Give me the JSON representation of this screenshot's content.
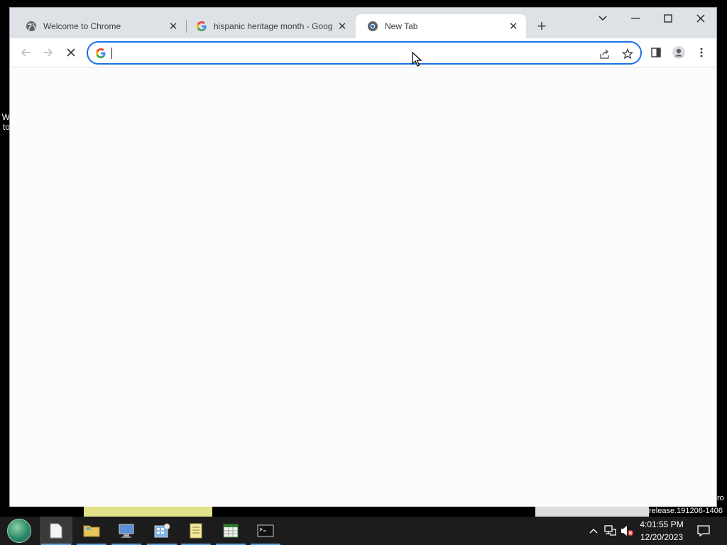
{
  "desktop": {
    "left_text": "W\nto",
    "right_text_a": "ro",
    "right_text_b": "release.191206-1406"
  },
  "browser": {
    "tabs": [
      {
        "title": "Welcome to Chrome",
        "icon": "globe-icon",
        "active": false
      },
      {
        "title": "hispanic heritage month - Google Search",
        "icon": "google-g-icon",
        "active": false
      },
      {
        "title": "New Tab",
        "icon": "chrome-icon",
        "active": true
      }
    ],
    "new_tab_label": "+",
    "omnibox": {
      "value": "",
      "placeholder": ""
    },
    "accent_color": "#1a73e8"
  },
  "taskbar": {
    "apps": [
      {
        "name": "file-explorer",
        "icon": "document-icon",
        "running": true,
        "active": true
      },
      {
        "name": "folder",
        "icon": "folder-icon",
        "running": true
      },
      {
        "name": "computer",
        "icon": "computer-icon",
        "running": true
      },
      {
        "name": "calculator",
        "icon": "calculator-icon",
        "running": true
      },
      {
        "name": "notepad",
        "icon": "notepad-icon",
        "running": true
      },
      {
        "name": "spreadsheet",
        "icon": "spreadsheet-icon",
        "running": true
      },
      {
        "name": "terminal",
        "icon": "terminal-icon",
        "running": true
      }
    ],
    "clock": {
      "time": "4:01:55 PM",
      "date": "12/20/2023"
    }
  }
}
